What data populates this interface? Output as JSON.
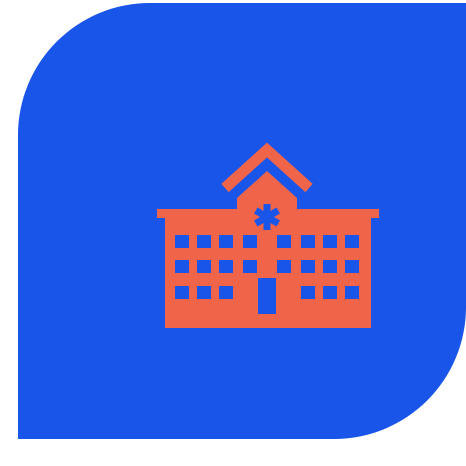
{
  "tile": {
    "background_color": "#1a55ea",
    "shape": "leaf-rounded-square"
  },
  "icon": {
    "name": "hospital-icon",
    "color": "#f0654a",
    "accent_color": "#1a55ea"
  }
}
